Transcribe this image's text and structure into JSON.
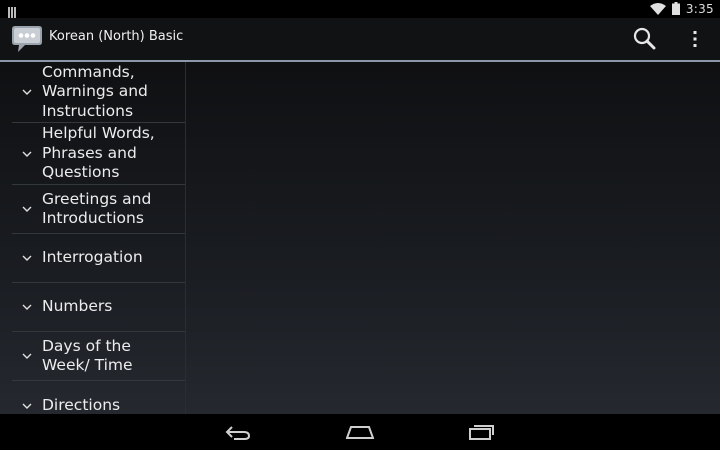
{
  "status_bar": {
    "time": "3:35",
    "icons": [
      "notification-icon",
      "wifi-icon",
      "battery-icon"
    ]
  },
  "action_bar": {
    "title": "Korean (North) Basic",
    "icons": [
      "app-chat-icon",
      "search-icon",
      "overflow-menu-icon"
    ]
  },
  "categories": [
    {
      "label": "Commands, Warnings and Instructions"
    },
    {
      "label": "Helpful Words, Phrases and Questions"
    },
    {
      "label": "Greetings and Introductions"
    },
    {
      "label": "Interrogation"
    },
    {
      "label": "Numbers"
    },
    {
      "label": "Days of the Week/ Time"
    },
    {
      "label": "Directions"
    }
  ],
  "nav_bar": {
    "icons": [
      "back-icon",
      "home-icon",
      "recents-icon"
    ]
  },
  "colors": {
    "accent_line": "#8a98a8",
    "background_top": "#0f1012",
    "background_bottom": "#25292f"
  }
}
